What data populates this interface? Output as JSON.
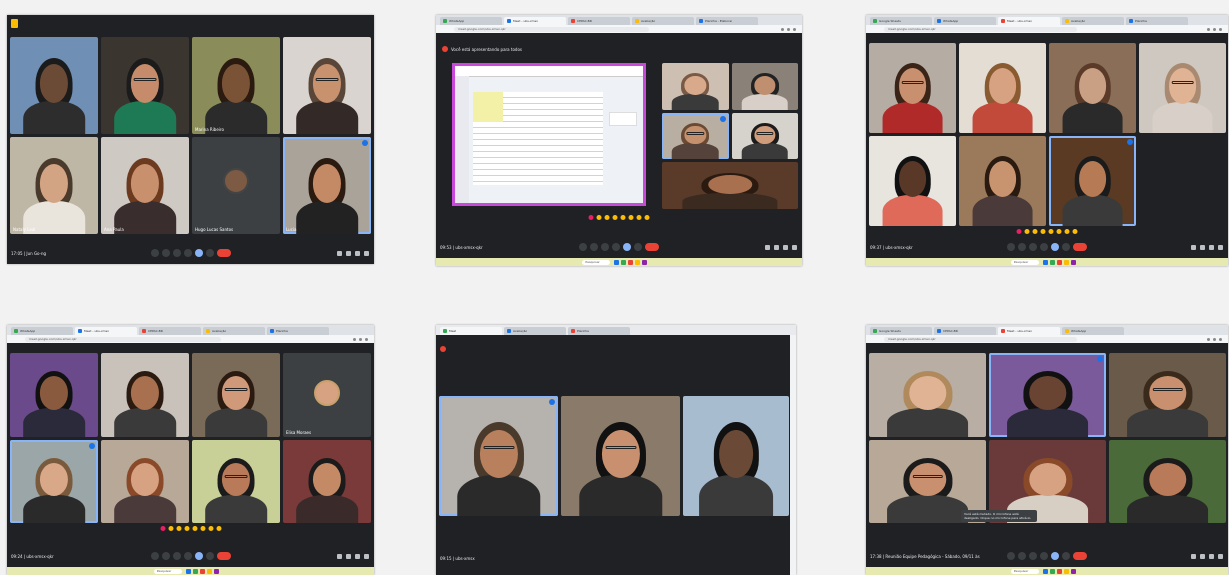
{
  "screens": [
    {
      "id": "s1",
      "tabs": [],
      "url": "",
      "banner": "",
      "bottom_left": "17:05 | Jun Go-ng",
      "tiles": [
        {
          "name": "",
          "bg": "#6f8fb5",
          "skin": "#6b4a36",
          "hair": "#1b1b1b",
          "shirt": "#2d2d2d",
          "glasses": false,
          "speaking": false
        },
        {
          "name": "",
          "bg": "#3b3530",
          "skin": "#c58b6a",
          "hair": "#1b1b1b",
          "shirt": "#1e7a55",
          "glasses": true,
          "speaking": false
        },
        {
          "name": "Marina Ribeiro",
          "bg": "#8a8d5a",
          "skin": "#7a5236",
          "hair": "#2a1a10",
          "shirt": "#2b2b2b",
          "glasses": false,
          "speaking": false
        },
        {
          "name": "",
          "bg": "#d9d4cf",
          "skin": "#c8926f",
          "hair": "#5a4638",
          "shirt": "#332a28",
          "glasses": true,
          "speaking": false
        },
        {
          "name": "Nataly Leal",
          "bg": "#bfb7a6",
          "skin": "#d3a483",
          "hair": "#4a3a2c",
          "shirt": "#e9e4dc",
          "glasses": false,
          "speaking": false
        },
        {
          "name": "Ana Paula",
          "bg": "#cfc9c4",
          "skin": "#c9906d",
          "hair": "#6b3a1f",
          "shirt": "#3a2d2d",
          "glasses": false,
          "speaking": false
        },
        {
          "name": "Hugo Lucas Santos",
          "bg": "#3c4043",
          "skin": "#7c5a44",
          "hair": "#111111",
          "shirt": "#444444",
          "glasses": false,
          "speaking": false,
          "avatar": true
        },
        {
          "name": "Lucia",
          "bg": "#a9a39a",
          "skin": "#c48a66",
          "hair": "#2a1a10",
          "shirt": "#222222",
          "glasses": false,
          "speaking": true
        }
      ]
    },
    {
      "id": "s2",
      "tabs": [
        "WhatsApp",
        "Meet - ubs-xmsx",
        "CEPAC-BR",
        "Avaliação",
        "Planilha - Elaborar"
      ],
      "url": "meet.google.com/ubs-xmsx-qkr",
      "banner": "Você está apresentando para todos",
      "bottom_left": "09:53 | ubs-xmsx-qkr",
      "tiles": [
        {
          "name": "",
          "bg": "#cdbfb1",
          "skin": "#d8a98a",
          "hair": "#7a5a44",
          "shirt": "#3a3a3a",
          "glasses": false,
          "speaking": false
        },
        {
          "name": "",
          "bg": "#8a8278",
          "skin": "#c08f70",
          "hair": "#222222",
          "shirt": "#d8d0c8",
          "glasses": false,
          "speaking": false
        },
        {
          "name": "",
          "bg": "#b9aea2",
          "skin": "#c4906e",
          "hair": "#6a4a32",
          "shirt": "#55423a",
          "glasses": true,
          "speaking": true
        },
        {
          "name": "",
          "bg": "#d6d2cc",
          "skin": "#cf9c7c",
          "hair": "#1b1b1b",
          "shirt": "#3a3a3a",
          "glasses": true,
          "speaking": false
        },
        {
          "name": "",
          "bg": "#5a3a28",
          "skin": "#a8704e",
          "hair": "#2a1a10",
          "shirt": "#3a2a20",
          "glasses": false,
          "speaking": false
        }
      ]
    },
    {
      "id": "s3",
      "tabs": [
        "Google Sheets",
        "WhatsApp",
        "Meet - ubs-xmsx",
        "Avaliação",
        "Planilha"
      ],
      "url": "meet.google.com/ubs-xmsx-qkr",
      "banner": "",
      "bottom_left": "09:37 | ubs-xmsx-qkr",
      "tiles": [
        {
          "name": "",
          "bg": "#b5ada4",
          "skin": "#c8906e",
          "hair": "#3a2418",
          "shirt": "#b02a2a",
          "glasses": true,
          "speaking": false
        },
        {
          "name": "",
          "bg": "#e4ddd4",
          "skin": "#d6a282",
          "hair": "#8a5a30",
          "shirt": "#c24a3a",
          "glasses": false,
          "speaking": false
        },
        {
          "name": "",
          "bg": "#8a6e58",
          "skin": "#caa084",
          "hair": "#5a3a28",
          "shirt": "#2a2a2a",
          "glasses": false,
          "speaking": false
        },
        {
          "name": "",
          "bg": "#cfc8c0",
          "skin": "#e0b394",
          "hair": "#a98a70",
          "shirt": "#d8d0c8",
          "glasses": true,
          "speaking": false
        },
        {
          "name": "",
          "bg": "#e8e4de",
          "skin": "#5a3828",
          "hair": "#111111",
          "shirt": "#e06a5a",
          "glasses": false,
          "speaking": false
        },
        {
          "name": "",
          "bg": "#9a7a5a",
          "skin": "#c8946f",
          "hair": "#2a1a10",
          "shirt": "#4a3a3a",
          "glasses": false,
          "speaking": false
        },
        {
          "name": "",
          "bg": "#5a3a22",
          "skin": "#b67a55",
          "hair": "#1b1b1b",
          "shirt": "#3a3a3a",
          "glasses": false,
          "speaking": true
        }
      ]
    },
    {
      "id": "s4",
      "tabs": [
        "WhatsApp",
        "Meet - ubs-xmsx",
        "CEPAC-BR",
        "Avaliação",
        "Planilha"
      ],
      "url": "meet.google.com/ubs-xmsx-qkr",
      "banner": "",
      "bottom_left": "09:24 | ubs-xmsx-qkr",
      "tiles": [
        {
          "name": "",
          "bg": "#6a4a8a",
          "skin": "#8a5a3e",
          "hair": "#111111",
          "shirt": "#2a2a3a",
          "glasses": false,
          "speaking": false
        },
        {
          "name": "",
          "bg": "#c8c2ba",
          "skin": "#a8704e",
          "hair": "#2a1a10",
          "shirt": "#3a3a3a",
          "glasses": false,
          "speaking": false
        },
        {
          "name": "",
          "bg": "#7a6a58",
          "skin": "#d09a7a",
          "hair": "#2a1a10",
          "shirt": "#3a3a3a",
          "glasses": true,
          "speaking": false
        },
        {
          "name": "Elisa Moraes",
          "bg": "#3c4043",
          "skin": "#d6a282",
          "hair": "#6a3a22",
          "shirt": "#c8a06a",
          "glasses": false,
          "speaking": false,
          "avatar": true
        },
        {
          "name": "",
          "bg": "#9aa6a8",
          "skin": "#d8a888",
          "hair": "#7a5a3c",
          "shirt": "#2a2a2a",
          "glasses": false,
          "speaking": true
        },
        {
          "name": "",
          "bg": "#b8a898",
          "skin": "#d6a282",
          "hair": "#8a4a2a",
          "shirt": "#4a3a3a",
          "glasses": false,
          "speaking": false
        },
        {
          "name": "",
          "bg": "#c8d098",
          "skin": "#b87a58",
          "hair": "#1b1b1b",
          "shirt": "#3a3a3a",
          "glasses": true,
          "speaking": false
        },
        {
          "name": "",
          "bg": "#7a3a3a",
          "skin": "#c48a66",
          "hair": "#1b1b1b",
          "shirt": "#3a2a2a",
          "glasses": false,
          "speaking": false
        }
      ]
    },
    {
      "id": "s5",
      "tabs": [
        "Meet",
        "Avaliação",
        "Planilha"
      ],
      "url": "",
      "banner": "",
      "bottom_left": "09:15 | ubs-xmsx",
      "tiles": [
        {
          "name": "",
          "bg": "#b6b3ae",
          "skin": "#b8805c",
          "hair": "#4a3a2c",
          "shirt": "#2a2a2a",
          "glasses": true,
          "speaking": true
        },
        {
          "name": "",
          "bg": "#8a7a6a",
          "skin": "#c8906e",
          "hair": "#111111",
          "shirt": "#2a2a2a",
          "glasses": true,
          "speaking": false
        },
        {
          "name": "",
          "bg": "#a8bccf",
          "skin": "#6a4a36",
          "hair": "#111111",
          "shirt": "#3a3a3a",
          "glasses": false,
          "speaking": false
        }
      ]
    },
    {
      "id": "s6",
      "tabs": [
        "Google Sheets",
        "CEPAC-BR",
        "Meet - ubs-xmsx",
        "WhatsApp"
      ],
      "url": "meet.google.com/ubs-xmsx-qkr",
      "banner": "",
      "bottom_left": "17:38 | Reunião Equipe Pedagógica - Sábado, 09/11 às",
      "tooltip": "Você está mutado. O microfone está desligado. Clique no microfone para ativá-lo.",
      "tiles": [
        {
          "name": "",
          "bg": "#b8aea4",
          "skin": "#e0b394",
          "hair": "#b08a5c",
          "shirt": "#3a3a3a",
          "glasses": false,
          "speaking": false
        },
        {
          "name": "",
          "bg": "#7a5a9a",
          "skin": "#6a4432",
          "hair": "#111111",
          "shirt": "#2a2a3a",
          "glasses": false,
          "speaking": true
        },
        {
          "name": "",
          "bg": "#6a5a4a",
          "skin": "#c8906e",
          "hair": "#3a2a1c",
          "shirt": "#3a3a3a",
          "glasses": true,
          "speaking": false
        },
        {
          "name": "",
          "bg": "#b8a898",
          "skin": "#c8906e",
          "hair": "#1b1b1b",
          "shirt": "#3a3a3a",
          "glasses": true,
          "speaking": false
        },
        {
          "name": "",
          "bg": "#6a3a3a",
          "skin": "#d6a282",
          "hair": "#8a4a2a",
          "shirt": "#d8cfc4",
          "glasses": false,
          "speaking": false
        },
        {
          "name": "",
          "bg": "#4a6a3a",
          "skin": "#b87a58",
          "hair": "#1b1b1b",
          "shirt": "#2a2a2a",
          "glasses": false,
          "speaking": false
        }
      ]
    }
  ],
  "colors": {
    "meet_bg": "#202124",
    "end_call": "#ea4335",
    "speaking": "#8ab4f8",
    "taskbar": "#e6eab0"
  },
  "icons": [
    "mic-icon",
    "camera-icon",
    "captions-icon",
    "raise-hand-icon",
    "present-icon",
    "more-icon",
    "end-call-icon",
    "info-icon",
    "people-icon",
    "chat-icon",
    "activities-icon"
  ]
}
